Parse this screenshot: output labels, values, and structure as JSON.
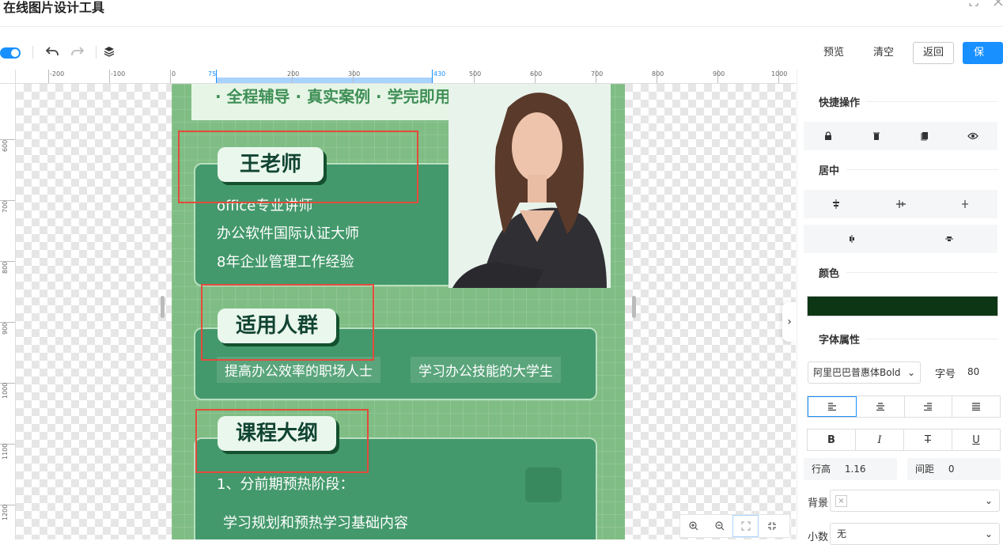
{
  "app": {
    "title": "在线图片设计工具"
  },
  "toolbar": {
    "preview_label": "预览",
    "clear_label": "清空",
    "back_label": "返回",
    "save_label": "保存",
    "icons": [
      "toggle",
      "undo-icon",
      "redo-icon",
      "layers-icon"
    ]
  },
  "ruler": {
    "top_labels": [
      "-200",
      "-100",
      "0",
      "75",
      "200",
      "300",
      "430",
      "500",
      "600",
      "700",
      "800",
      "900",
      "1000"
    ],
    "left_labels": [
      "600",
      "700",
      "800",
      "900",
      "1000",
      "1100",
      "1200"
    ]
  },
  "poster": {
    "tagline": "· 全程辅导 · 真实案例 · 学完即用",
    "teacher_title": "王老师",
    "teacher_lines": [
      "office专业讲师",
      "办公软件国际认证大师",
      "8年企业管理工作经验"
    ],
    "audience_title": "适用人群",
    "audience_tags": [
      "提高办公效率的职场人士",
      "学习办公技能的大学生"
    ],
    "outline_title": "课程大纲",
    "outline_lines": [
      "1、分前期预热阶段：",
      "学习规划和预热学习基础内容"
    ]
  },
  "panel": {
    "quick_ops_title": "快捷操作",
    "quick_ops_icons": [
      "lock-icon",
      "trash-icon",
      "copy-icon",
      "eye-icon"
    ],
    "center_title": "居中",
    "color_title": "颜色",
    "color_value": "#0c3614",
    "font_title": "字体属性",
    "font_family": "阿里巴巴普惠体Bold",
    "font_size_label": "字号",
    "font_size": "80",
    "line_height_label": "行高",
    "line_height": "1.16",
    "spacing_label": "间距",
    "spacing": "0",
    "background_label": "背景",
    "decimal_label": "小数",
    "decimal_value": "无",
    "style_buttons": [
      "B",
      "I",
      "T",
      "U"
    ]
  },
  "colors": {
    "accent": "#1890ff",
    "poster_green": "#7fbd84",
    "card_green": "#44996c",
    "highlight_red": "#e34b3b"
  }
}
